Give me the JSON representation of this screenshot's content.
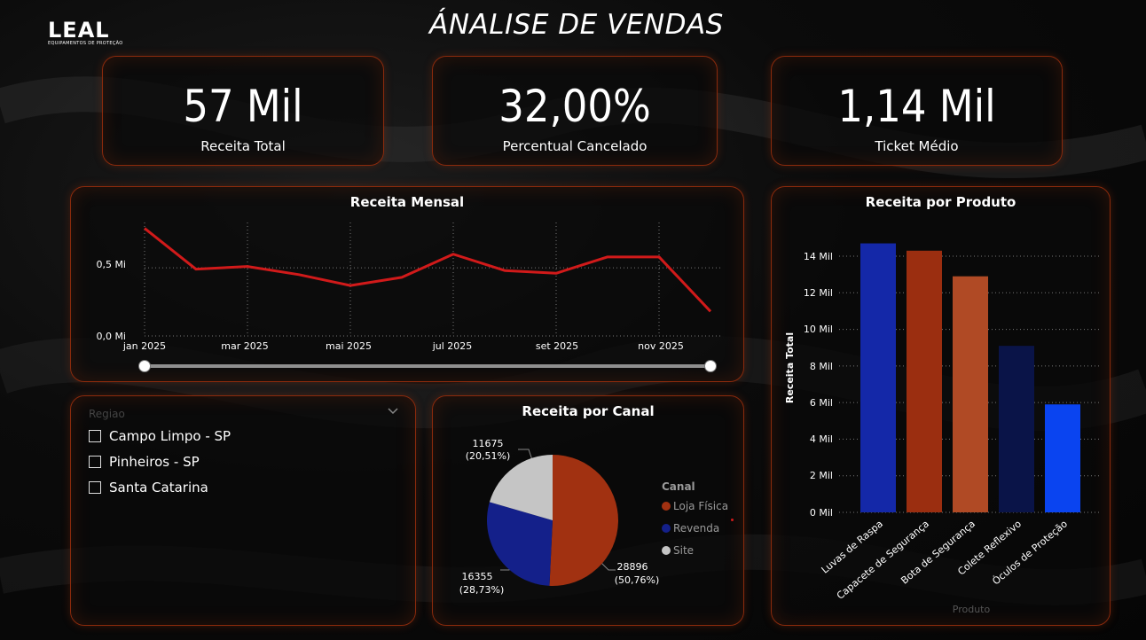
{
  "header": {
    "logo_main": "LEAL",
    "logo_sub": "EQUIPAMENTOS DE PROTEÇÃO",
    "title": "ÁNALISE DE VENDAS"
  },
  "kpis": [
    {
      "value": "57 Mil",
      "label": "Receita Total"
    },
    {
      "value": "32,00%",
      "label": "Percentual Cancelado"
    },
    {
      "value": "1,14 Mil",
      "label": "Ticket Médio"
    }
  ],
  "colors": {
    "accent": "#8a2a0c",
    "line": "#d11a1a",
    "loja_fisica": "#a13111",
    "revenda": "#14208a",
    "site": "#c5c5c5"
  },
  "monthly": {
    "title": "Receita Mensal",
    "y_ticks": [
      "0,5 Mi",
      "0,0 Mi"
    ],
    "x_ticks": [
      "jan 2025",
      "mar 2025",
      "mai 2025",
      "jul 2025",
      "set 2025",
      "nov 2025"
    ]
  },
  "slicer": {
    "header": "Regiao",
    "items": [
      "Campo Limpo - SP",
      "Pinheiros - SP",
      "Santa Catarina"
    ]
  },
  "channel": {
    "title": "Receita por Canal",
    "legend_title": "Canal",
    "legend": [
      "Loja Física",
      "Revenda",
      "Site"
    ],
    "labels": [
      {
        "value": "28896",
        "pct": "(50,76%)"
      },
      {
        "value": "16355",
        "pct": "(28,73%)"
      },
      {
        "value": "11675",
        "pct": "(20,51%)"
      }
    ]
  },
  "product": {
    "title": "Receita por Produto",
    "ylabel": "Receita Total",
    "xlabel": "Produto",
    "y_ticks": [
      "14 Mil",
      "12 Mil",
      "10 Mil",
      "8 Mil",
      "6 Mil",
      "4 Mil",
      "2 Mil",
      "0 Mil"
    ]
  },
  "chart_data": [
    {
      "type": "line",
      "title": "Receita Mensal",
      "x": [
        "jan 2025",
        "fev 2025",
        "mar 2025",
        "abr 2025",
        "mai 2025",
        "jun 2025",
        "jul 2025",
        "ago 2025",
        "set 2025",
        "out 2025",
        "nov 2025",
        "dez 2025"
      ],
      "series": [
        {
          "values": [
            0.79,
            0.49,
            0.51,
            0.45,
            0.37,
            0.43,
            0.6,
            0.48,
            0.46,
            0.58,
            0.58,
            0.18
          ]
        }
      ],
      "yunit": "Mi",
      "ylim": [
        0,
        0.8
      ],
      "grid": true
    },
    {
      "type": "pie",
      "title": "Receita por Canal",
      "categories": [
        "Loja Física",
        "Revenda",
        "Site"
      ],
      "values": [
        28896,
        16355,
        11675
      ],
      "percents": [
        50.76,
        28.73,
        20.51
      ],
      "legend": "right"
    },
    {
      "type": "bar",
      "title": "Receita por Produto",
      "categories": [
        "Luvas de Raspa",
        "Capacete de Segurança",
        "Bota de Segurança",
        "Colete Reflexivo",
        "Óculos de Proteção"
      ],
      "values": [
        14.7,
        14.3,
        12.9,
        9.1,
        5.9
      ],
      "colors": [
        "#1428a8",
        "#9b2e10",
        "#b04a25",
        "#0a1448",
        "#0a44f0"
      ],
      "yunit": "Mil",
      "ylim": [
        0,
        15
      ],
      "xlabel": "Produto",
      "ylabel": "Receita Total",
      "grid": true
    }
  ]
}
